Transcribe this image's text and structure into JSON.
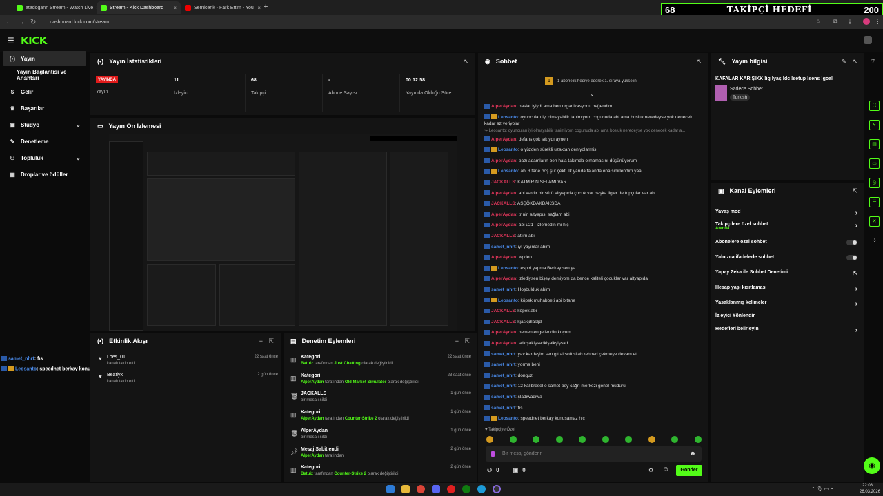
{
  "browser": {
    "tabs": [
      {
        "title": "atadogann Stream - Watch Live",
        "active": false,
        "favicon": "kick-icon"
      },
      {
        "title": "Stream - Kick Dashboard",
        "active": true,
        "favicon": "kick-icon"
      },
      {
        "title": "Semicenk - Fark Ettim - You",
        "active": false,
        "favicon": "youtube-icon"
      }
    ],
    "new_tab": "+",
    "url": "dashboard.kick.com/stream",
    "follower_goal": {
      "current": "68",
      "label": "TAKİPÇİ HEDEFİ",
      "target": "200"
    }
  },
  "app": {
    "logo": "KICK"
  },
  "sidebar": {
    "items": [
      {
        "label": "Yayın",
        "icon": "broadcast-icon",
        "active": true
      },
      {
        "label": "Yayın Bağlantısı ve Anahtarı",
        "icon": "",
        "active": false
      },
      {
        "label": "Gelir",
        "icon": "dollar-icon",
        "active": false
      },
      {
        "label": "Başarılar",
        "icon": "trophy-icon",
        "active": false
      },
      {
        "label": "Stüdyo",
        "icon": "studio-icon",
        "active": false,
        "expandable": true
      },
      {
        "label": "Denetleme",
        "icon": "wrench-icon",
        "active": false
      },
      {
        "label": "Topluluk",
        "icon": "community-icon",
        "active": false,
        "expandable": true
      },
      {
        "label": "Droplar ve ödüller",
        "icon": "gift-icon",
        "active": false
      }
    ],
    "overlay_chat": [
      {
        "user": "samet_nhrt",
        "text": ": fıs"
      },
      {
        "user": "Leosanto",
        "text": ": speednet berkay konusamaz hic"
      }
    ]
  },
  "stats": {
    "title": "Yayın İstatistikleri",
    "items": [
      {
        "value": "YAYINDA",
        "label": "Yayın"
      },
      {
        "value": "11",
        "label": "İzleyici"
      },
      {
        "value": "68",
        "label": "Takipçi"
      },
      {
        "value": "-",
        "label": "Abone Sayısı"
      },
      {
        "value": "00:12:58",
        "label": "Yayında Olduğu Süre"
      }
    ]
  },
  "preview": {
    "title": "Yayın Ön İzlemesi"
  },
  "activity": {
    "title": "Etkinlik Akışı",
    "items": [
      {
        "name": "Loes_01",
        "sub": "kanalı takip etti",
        "time": "22 saat önce"
      },
      {
        "name": "Beatlyx",
        "sub": "kanalı takip etti",
        "time": "2 gün önce"
      }
    ]
  },
  "moderation": {
    "title": "Denetim Eylemleri",
    "items": [
      {
        "icon": "category-icon",
        "title": "Kategori",
        "actor": "Batuiz",
        "mid": " tarafından ",
        "target": "Just Chatting",
        "tail": " olarak değiştirildi",
        "time": "22 saat önce"
      },
      {
        "icon": "category-icon",
        "title": "Kategori",
        "actor": "AlperAydan",
        "mid": " tarafından ",
        "target": "Old Market Simulator",
        "tail": " olarak değiştirildi",
        "time": "23 saat önce"
      },
      {
        "icon": "trash-icon",
        "title": "JACKALLS",
        "actor": "",
        "mid": "bir mesajı sildi",
        "target": "",
        "tail": "",
        "time": "1 gün önce"
      },
      {
        "icon": "category-icon",
        "title": "Kategori",
        "actor": "AlperAydan",
        "mid": " tarafından ",
        "target": "Counter-Strike 2",
        "tail": " olarak değiştirildi",
        "time": "1 gün önce"
      },
      {
        "icon": "trash-icon",
        "title": "AlperAydan",
        "actor": "",
        "mid": "bir mesajı sildi",
        "target": "",
        "tail": "",
        "time": "1 gün önce"
      },
      {
        "icon": "pin-icon",
        "title": "Mesaj Sabitlendi",
        "actor": "AlperAydan",
        "mid": " tarafından",
        "target": "",
        "tail": "",
        "time": "2 gün önce"
      },
      {
        "icon": "category-icon",
        "title": "Kategori",
        "actor": "Batuiz",
        "mid": " tarafından ",
        "target": "Counter-Strike 2",
        "tail": " olarak değiştirildi",
        "time": "2 gün önce"
      }
    ]
  },
  "chat": {
    "title": "Sohbet",
    "gift_banner": "1 abonelik hediye ederek 1. sıraya yükselin",
    "messages": [
      {
        "user": "AlperAydan",
        "color": "#e0365a",
        "text": ": paslar iyiydi ama ben organizasyonu beğendim",
        "badge": "badge"
      },
      {
        "user": "Leosanto",
        "color": "#4b8bea",
        "text": ": oyuncuları iyi olmayabilir tanimiyorn cogunuda abi ama bosluk neredeyse yok denecek kadar az veriyolar",
        "badge": "badge2"
      },
      {
        "user": "",
        "color": "#888",
        "text": "↪ Leosanto: oyuncuları iyi olmayabilir tanimiyorn cogunuda abi ama bosluk neredeyse yok denecek kadar a...",
        "badge": ""
      },
      {
        "user": "AlperAydan",
        "color": "#e0365a",
        "text": ": defans çok sıkıydı aynen",
        "badge": "badge"
      },
      {
        "user": "Leosanto",
        "color": "#4b8bea",
        "text": ": o yüzden sürekli uzaktan deniyolarmis",
        "badge": "badge2"
      },
      {
        "user": "AlperAydan",
        "color": "#e0365a",
        "text": ": bazı adamların ben hala takımda olmamasını düşünüyorum",
        "badge": "badge"
      },
      {
        "user": "Leosanto",
        "color": "#4b8bea",
        "text": ": abi 3 tane boş şut çekti ilk yarıda falanda ona sinirlendim yaa",
        "badge": "badge2"
      },
      {
        "user": "JACKALLS",
        "color": "#e0365a",
        "text": ": KATMİRİN SELAMI VAR",
        "badge": "badge"
      },
      {
        "user": "AlperAydan",
        "color": "#e0365a",
        "text": ": abi vardır bir sürü altyapıda çocuk var başka ligler de topçular var abi",
        "badge": "badge"
      },
      {
        "user": "JACKALLS",
        "color": "#e0365a",
        "text": ": AŞŞÖKDAKDAKSDA",
        "badge": "badge"
      },
      {
        "user": "AlperAydan",
        "color": "#e0365a",
        "text": ": tr nin altyapısı sağlam abi",
        "badge": "badge"
      },
      {
        "user": "AlperAydan",
        "color": "#e0365a",
        "text": ": abi u21 i izlemedin mi hiç",
        "badge": "badge"
      },
      {
        "user": "JACKALLS",
        "color": "#e0365a",
        "text": ": atlım abi",
        "badge": "badge"
      },
      {
        "user": "samet_nhrt",
        "color": "#4b8bea",
        "text": ": iyi yayınlar abim",
        "badge": "badge"
      },
      {
        "user": "AlperAydan",
        "color": "#e0365a",
        "text": ": wpden",
        "badge": "badge"
      },
      {
        "user": "Leosanto",
        "color": "#4b8bea",
        "text": ": espiri yapma Berkay sen ya",
        "badge": "badge2"
      },
      {
        "user": "AlperAydan",
        "color": "#e0365a",
        "text": ": izlediysen bişey demiyom da bence kaliteli çocuklar var altyapıda",
        "badge": "badge"
      },
      {
        "user": "samet_nhrt",
        "color": "#4b8bea",
        "text": ": Hoşbulduk abim",
        "badge": "badge"
      },
      {
        "user": "Leosanto",
        "color": "#4b8bea",
        "text": ": köpek muhabbeti abi bitane",
        "badge": "badge2"
      },
      {
        "user": "JACKALLS",
        "color": "#e0365a",
        "text": ": köpek abi",
        "badge": "badge"
      },
      {
        "user": "JACKALLS",
        "color": "#e0365a",
        "text": ": kjaskjdlasljd",
        "badge": "badge"
      },
      {
        "user": "AlperAydan",
        "color": "#e0365a",
        "text": ": hemen engellendin koçum",
        "badge": "badge"
      },
      {
        "user": "AlperAydan",
        "color": "#e0365a",
        "text": ": sdklşaklşsadklşalkşlşsad",
        "badge": "badge"
      },
      {
        "user": "samet_nhrt",
        "color": "#4b8bea",
        "text": ": yav kardeşim sen git airsoft silah rehberi çekmeye devam et",
        "badge": "badge"
      },
      {
        "user": "samet_nhrt",
        "color": "#4b8bea",
        "text": ": yorma beni",
        "badge": "badge"
      },
      {
        "user": "samet_nhrt",
        "color": "#4b8bea",
        "text": ": donguz",
        "badge": "badge"
      },
      {
        "user": "samet_nhrt",
        "color": "#4b8bea",
        "text": ": 12 kalibresel o samet bey cağrı merkezi genel müdürü",
        "badge": "badge"
      },
      {
        "user": "samet_nhrt",
        "color": "#4b8bea",
        "text": ": şladiwadiwa",
        "badge": "badge"
      },
      {
        "user": "samet_nhrt",
        "color": "#4b8bea",
        "text": ": fıs",
        "badge": "badge"
      },
      {
        "user": "Leosanto",
        "color": "#4b8bea",
        "text": ": speednet berkay konusamaz hic",
        "badge": "badge2"
      }
    ],
    "followers_only_label": "Takipçiye Özel",
    "input_placeholder": "Bir mesaj gönderin",
    "counter_left": "0",
    "counter_right": "0",
    "send_label": "Gönder"
  },
  "stream_info": {
    "title": "Yayın bilgisi",
    "stream_title": "KAFALAR KARIŞIKK !ig !yaş !dc !setup !sens !goal",
    "category": "Sadece Sohbet",
    "language": "Turkish"
  },
  "channel_actions": {
    "title": "Kanal Eylemleri",
    "items": [
      {
        "label": "Yavaş mod",
        "sub": "",
        "control": "chevron"
      },
      {
        "label": "Takipçilere özel sohbet",
        "sub": "Anında",
        "control": "chevron"
      },
      {
        "label": "Abonelere özel sohbet",
        "sub": "",
        "control": "toggle"
      },
      {
        "label": "Yalnızca ifadelerle sohbet",
        "sub": "",
        "control": "toggle"
      },
      {
        "label": "Yapay Zeka ile Sohbet Denetimi",
        "sub": "",
        "control": "external"
      },
      {
        "label": "Hesap yaşı kısıtlaması",
        "sub": "",
        "control": "chevron"
      },
      {
        "label": "Yasaklanmış kelimeler",
        "sub": "",
        "control": "chevron"
      },
      {
        "label": "İzleyici Yönlendir",
        "sub": "",
        "control": "none"
      },
      {
        "label": "Hedefleri belirleyin",
        "sub": "",
        "control": "chevron"
      }
    ]
  },
  "taskbar": {
    "time": "22:08",
    "date": "26.03.2026"
  },
  "colors": {
    "accent": "#53fc18",
    "live": "#e21b1b"
  }
}
